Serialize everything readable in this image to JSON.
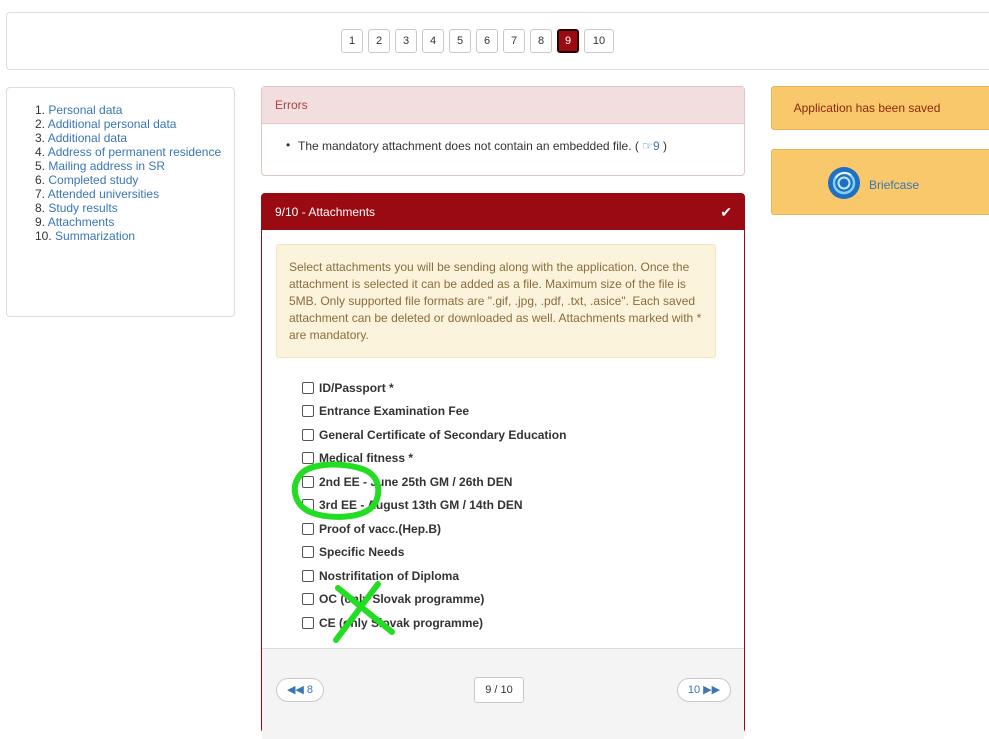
{
  "pager": {
    "pages": [
      "1",
      "2",
      "3",
      "4",
      "5",
      "6",
      "7",
      "8",
      "9",
      "10"
    ],
    "current": "9"
  },
  "nav": {
    "items": [
      {
        "num": "1.",
        "label": "Personal data"
      },
      {
        "num": "2.",
        "label": "Additional personal data"
      },
      {
        "num": "3.",
        "label": "Additional data"
      },
      {
        "num": "4.",
        "label": "Address of permanent residence"
      },
      {
        "num": "5.",
        "label": "Mailing address in SR"
      },
      {
        "num": "6.",
        "label": "Completed study"
      },
      {
        "num": "7.",
        "label": "Attended universities"
      },
      {
        "num": "8.",
        "label": "Study results"
      },
      {
        "num": "9.",
        "label": "Attachments"
      },
      {
        "num": "10.",
        "label": "Summarization"
      }
    ]
  },
  "errors": {
    "title": "Errors",
    "bullet": "•",
    "message": "The mandatory attachment does not contain an embedded file. (",
    "link_icon": "☞",
    "link_text": "9",
    "message_end": ")"
  },
  "attachments": {
    "title": "9/10 - Attachments",
    "check_icon": "✔",
    "info": "Select attachments you will be sending along with the application. Once the attachment is selected it can be added as a file. Maximum size of the file is 5MB. Only supported file formats are \".gif, .jpg, .pdf, .txt, .asice\". Each saved attachment can be deleted or downloaded as well. Attachments marked with * are mandatory.",
    "items": [
      "ID/Passport *",
      "Entrance Examination Fee",
      "General Certificate of Secondary Education",
      "Medical fitness *",
      "2nd EE - June 25th GM / 26th DEN",
      "3rd EE - August 13th GM / 14th DEN",
      "Proof of vacc.(Hep.B)",
      "Specific Needs",
      "Nostrifitation of Diploma",
      "OC (only Slovak programme)",
      "CE (only Slovak programme)"
    ],
    "prev_label": "◀◀ 8",
    "page_label": "9 / 10",
    "next_label": "10 ▶▶"
  },
  "sidebar": {
    "saved_text": "Application has been saved",
    "briefcase_label": "Briefcase",
    "briefcase_icon": "briefcase-logo-icon"
  },
  "colors": {
    "accent": "#9a0a12",
    "panel_yellow": "#f9c86a",
    "link": "#3a76b5",
    "annotation": "#22dd22"
  }
}
